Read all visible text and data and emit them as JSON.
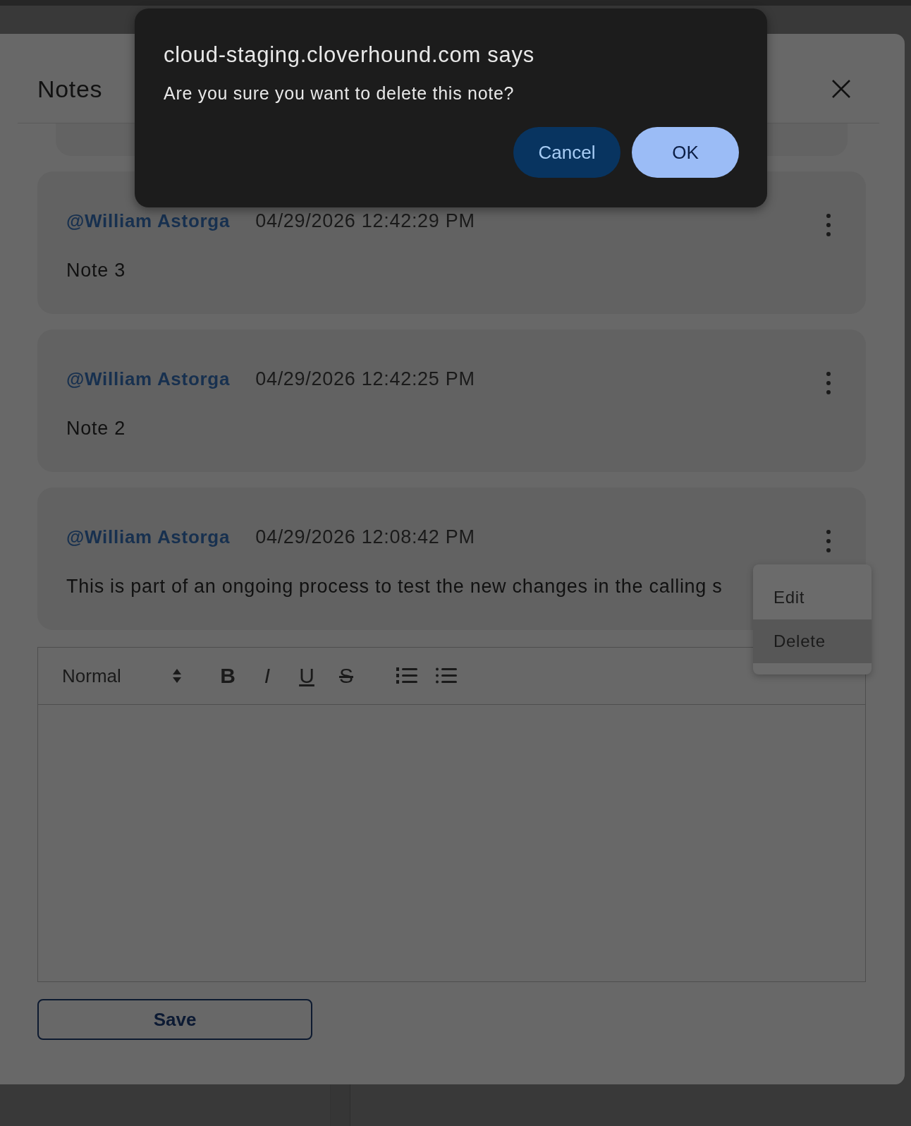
{
  "dialog": {
    "title": "cloud-staging.cloverhound.com says",
    "message": "Are you sure you want to delete this note?",
    "buttons": [
      {
        "label": "Cancel",
        "kind": "secondary"
      },
      {
        "label": "OK",
        "kind": "primary"
      }
    ]
  },
  "panel": {
    "title": "Notes"
  },
  "notes": [
    {
      "author": "@William Astorga",
      "timestamp": "04/29/2026 12:42:29 PM",
      "body": "Note 3",
      "menu_open": false
    },
    {
      "author": "@William Astorga",
      "timestamp": "04/29/2026 12:42:25 PM",
      "body": "Note 2",
      "menu_open": false
    },
    {
      "author": "@William Astorga",
      "timestamp": "04/29/2026 12:08:42 PM",
      "body": "This is part of an ongoing process to test the new changes in the calling s",
      "menu_open": true
    }
  ],
  "note_menu": {
    "items": [
      {
        "label": "Edit",
        "selected": false
      },
      {
        "label": "Delete",
        "selected": true
      }
    ]
  },
  "editor": {
    "format": "Normal",
    "tools": [
      {
        "kind": "bold",
        "label": "B"
      },
      {
        "kind": "italic",
        "label": "I"
      },
      {
        "kind": "underline",
        "label": "U"
      },
      {
        "kind": "strike",
        "label": "S"
      },
      {
        "kind": "ordered-list"
      },
      {
        "kind": "bullet-list"
      }
    ]
  },
  "save_button": "Save"
}
